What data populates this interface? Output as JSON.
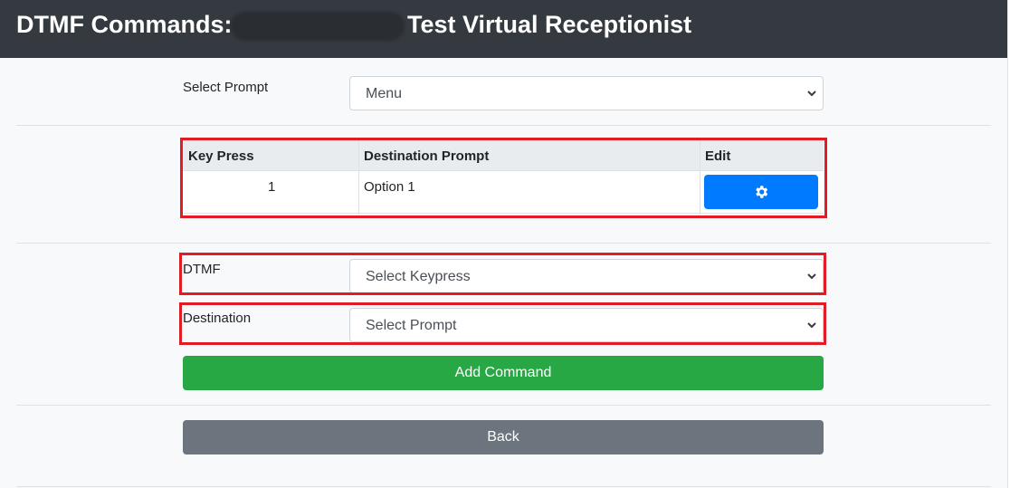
{
  "header": {
    "title_prefix": "DTMF Commands:",
    "title_suffix": "Test Virtual Receptionist"
  },
  "prompt_select": {
    "label": "Select Prompt",
    "value": "Menu"
  },
  "table": {
    "columns": [
      "Key Press",
      "Destination Prompt",
      "Edit"
    ],
    "rows": [
      {
        "key_press": "1",
        "destination_prompt": "Option 1",
        "edit_icon": "gear-icon"
      }
    ]
  },
  "form": {
    "dtmf_label": "DTMF",
    "dtmf_value": "Select Keypress",
    "destination_label": "Destination",
    "destination_value": "Select Prompt",
    "add_button": "Add Command",
    "back_button": "Back"
  },
  "colors": {
    "header_bg": "#343a40",
    "primary": "#007bff",
    "success": "#28a745",
    "secondary": "#6c757d",
    "highlight": "#e01c24"
  }
}
